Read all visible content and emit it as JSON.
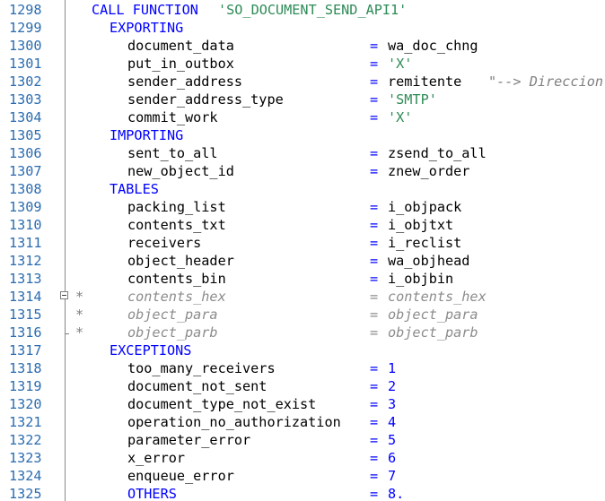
{
  "editor": {
    "lines": [
      {
        "n": "1298",
        "kind": "call",
        "kw": "CALL FUNCTION",
        "str": "'SO_DOCUMENT_SEND_API1'"
      },
      {
        "n": "1299",
        "kind": "section",
        "text": "EXPORTING"
      },
      {
        "n": "1300",
        "kind": "param",
        "name": "document_data",
        "value": "wa_doc_chng",
        "vtype": "id"
      },
      {
        "n": "1301",
        "kind": "param",
        "name": "put_in_outbox",
        "value": "'X'",
        "vtype": "str"
      },
      {
        "n": "1302",
        "kind": "param",
        "name": "sender_address",
        "value": "remitente",
        "vtype": "id",
        "note": "\"--> Direccion"
      },
      {
        "n": "1303",
        "kind": "param",
        "name": "sender_address_type",
        "value": "'SMTP'",
        "vtype": "str"
      },
      {
        "n": "1304",
        "kind": "param",
        "name": "commit_work",
        "value": "'X'",
        "vtype": "str"
      },
      {
        "n": "1305",
        "kind": "section",
        "text": "IMPORTING"
      },
      {
        "n": "1306",
        "kind": "param",
        "name": "sent_to_all",
        "value": "zsend_to_all",
        "vtype": "id"
      },
      {
        "n": "1307",
        "kind": "param",
        "name": "new_object_id",
        "value": "znew_order",
        "vtype": "id"
      },
      {
        "n": "1308",
        "kind": "section",
        "text": "TABLES"
      },
      {
        "n": "1309",
        "kind": "param",
        "name": "packing_list",
        "value": "i_objpack",
        "vtype": "id"
      },
      {
        "n": "1310",
        "kind": "param",
        "name": "contents_txt",
        "value": "i_objtxt",
        "vtype": "id"
      },
      {
        "n": "1311",
        "kind": "param",
        "name": "receivers",
        "value": "i_reclist",
        "vtype": "id"
      },
      {
        "n": "1312",
        "kind": "param",
        "name": "object_header",
        "value": "wa_objhead",
        "vtype": "id"
      },
      {
        "n": "1313",
        "kind": "param",
        "name": "contents_bin",
        "value": "i_objbin",
        "vtype": "id"
      },
      {
        "n": "1314",
        "kind": "comment",
        "star": "*",
        "name": "contents_hex",
        "value": "contents_hex"
      },
      {
        "n": "1315",
        "kind": "comment",
        "star": "*",
        "name": "object_para",
        "value": "object_para"
      },
      {
        "n": "1316",
        "kind": "comment",
        "star": "*",
        "name": "object_parb",
        "value": "object_parb"
      },
      {
        "n": "1317",
        "kind": "section",
        "text": "EXCEPTIONS"
      },
      {
        "n": "1318",
        "kind": "param",
        "name": "too_many_receivers",
        "value": "1",
        "vtype": "num"
      },
      {
        "n": "1319",
        "kind": "param",
        "name": "document_not_sent",
        "value": "2",
        "vtype": "num"
      },
      {
        "n": "1320",
        "kind": "param",
        "name": "document_type_not_exist",
        "value": "3",
        "vtype": "num"
      },
      {
        "n": "1321",
        "kind": "param",
        "name": "operation_no_authorization",
        "value": "4",
        "vtype": "num"
      },
      {
        "n": "1322",
        "kind": "param",
        "name": "parameter_error",
        "value": "5",
        "vtype": "num"
      },
      {
        "n": "1323",
        "kind": "param",
        "name": "x_error",
        "value": "6",
        "vtype": "num"
      },
      {
        "n": "1324",
        "kind": "param",
        "name": "enqueue_error",
        "value": "7",
        "vtype": "num"
      },
      {
        "n": "1325",
        "kind": "param",
        "name": "OTHERS",
        "value": "8.",
        "vtype": "num",
        "nametype": "kw"
      }
    ],
    "operator": "=",
    "colors": {
      "keyword": "#0000ff",
      "string": "#2e8b57",
      "number": "#0000ff",
      "comment": "#8c8c8c",
      "line_number": "#2b6cb0"
    },
    "fold_icon": "collapse-minus-icon"
  }
}
